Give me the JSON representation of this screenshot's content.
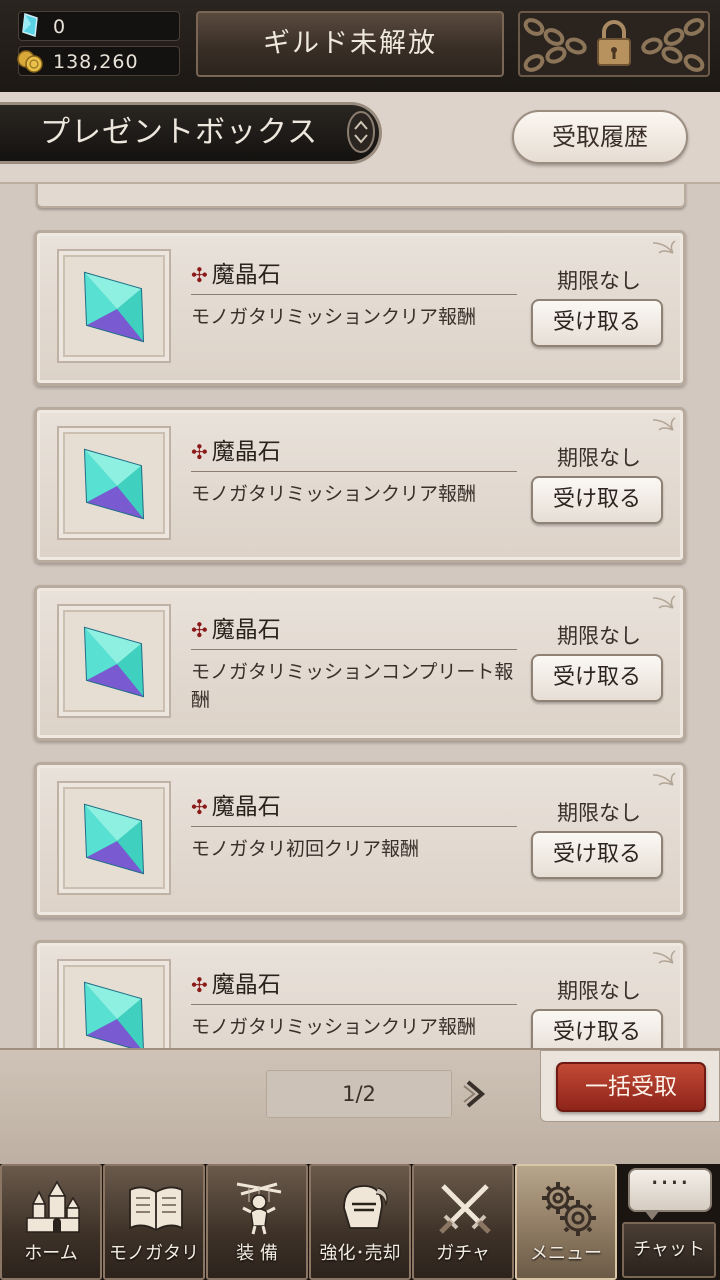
{
  "currency": {
    "gems": "0",
    "gold": "138,260"
  },
  "topbar": {
    "guild_button": "ギルド未解放",
    "locked_icon": "chained-lock-icon"
  },
  "header": {
    "title": "プレゼントボックス",
    "sort_icon": "sort-arrows-icon",
    "history_button": "受取履歴"
  },
  "items": [
    {
      "name": "魔晶石",
      "description": "モノガタリミッションクリア報酬",
      "expiry": "期限なし",
      "button": "受け取る",
      "icon": "crystal-icon"
    },
    {
      "name": "魔晶石",
      "description": "モノガタリミッションクリア報酬",
      "expiry": "期限なし",
      "button": "受け取る",
      "icon": "crystal-icon"
    },
    {
      "name": "魔晶石",
      "description": "モノガタリミッションコンプリート報酬",
      "expiry": "期限なし",
      "button": "受け取る",
      "icon": "crystal-icon"
    },
    {
      "name": "魔晶石",
      "description": "モノガタリ初回クリア報酬",
      "expiry": "期限なし",
      "button": "受け取る",
      "icon": "crystal-icon"
    },
    {
      "name": "魔晶石",
      "description": "モノガタリミッションクリア報酬",
      "expiry": "期限なし",
      "button": "受け取る",
      "icon": "crystal-icon"
    }
  ],
  "pagination": {
    "page": "1/2"
  },
  "bulk_button": "一括受取",
  "nav": [
    {
      "label": "ホーム",
      "icon": "castle-icon"
    },
    {
      "label": "モノガタリ",
      "icon": "open-book-icon"
    },
    {
      "label": "装 備",
      "icon": "puppet-icon"
    },
    {
      "label": "強化･売却",
      "icon": "helmet-icon"
    },
    {
      "label": "ガチャ",
      "icon": "crossed-swords-icon"
    },
    {
      "label": "メニュー",
      "icon": "gears-icon"
    }
  ],
  "chat": {
    "label": "チャット",
    "bubble": "····",
    "icon": "chat-bubble-icon"
  },
  "colors": {
    "accent_red": "#a8321f",
    "item_cross": "#8a1a1a",
    "crystal": "#3fd0c0"
  }
}
